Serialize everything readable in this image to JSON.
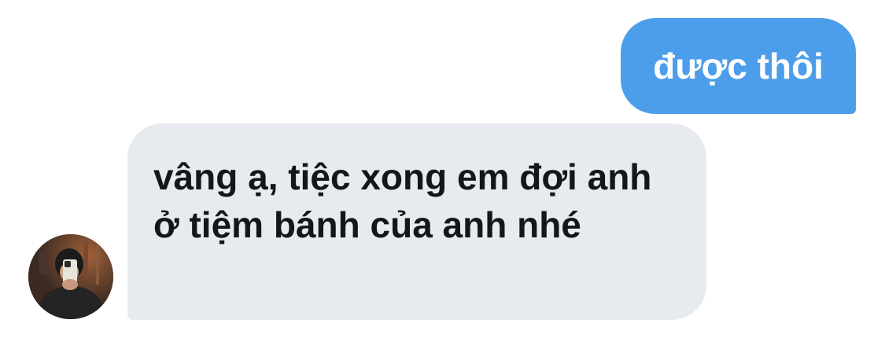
{
  "conversation": {
    "messages": [
      {
        "direction": "outgoing",
        "text": "được thôi"
      },
      {
        "direction": "incoming",
        "text": "vâng ạ, tiệc xong em đợi anh ở tiệm bánh của anh nhé"
      }
    ],
    "participant": {
      "avatar": "profile-photo"
    }
  },
  "colors": {
    "outgoing_bubble": "#4c9eeb",
    "incoming_bubble": "#e7ebef",
    "outgoing_text": "#ffffff",
    "incoming_text": "#14171a"
  }
}
